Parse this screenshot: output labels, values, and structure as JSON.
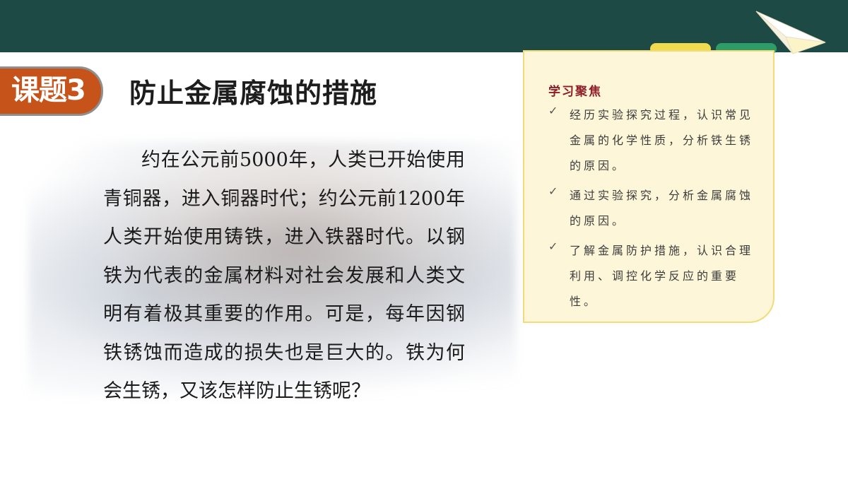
{
  "header": {
    "lesson_label": "课题3",
    "title": "防止金属腐蚀的措施"
  },
  "intro": {
    "text": "约在公元前5000年，人类已开始使用青铜器，进入铜器时代；约公元前1200年人类开始使用铸铁，进入铁器时代。以钢铁为代表的金属材料对社会发展和人类文明有着极其重要的作用。可是，每年因钢铁锈蚀而造成的损失也是巨大的。铁为何会生锈，又该怎样防止生锈呢？"
  },
  "focus": {
    "heading": "学习聚焦",
    "items": [
      {
        "icon": "check-icon",
        "text": "经历实验探究过程，认识常见金属的化学性质，分析铁生锈的原因。"
      },
      {
        "icon": "check-icon",
        "text": "通过实验探究，分析金属腐蚀的原因。"
      },
      {
        "icon": "check-icon",
        "text": "了解金属防护措施，认识合理利用、调控化学反应的重要性。"
      }
    ]
  },
  "colors": {
    "top_bar": "#1e4a45",
    "badge": "#c5531a",
    "card_bg": "#fdf6d8",
    "card_border": "#f0dc7a",
    "heading_red": "#8e1d2a",
    "tape_yellow": "#f0db4e",
    "tape_green": "#2d9c67"
  }
}
